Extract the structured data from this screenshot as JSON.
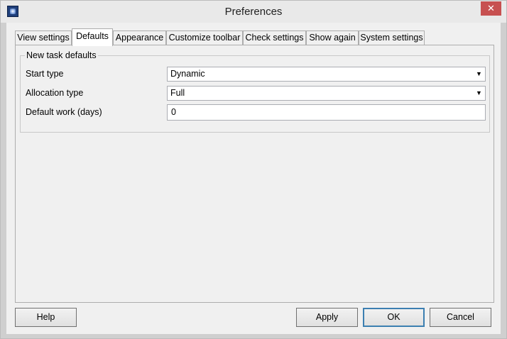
{
  "window": {
    "title": "Preferences",
    "close_glyph": "✕"
  },
  "tabs": [
    {
      "label": "View settings"
    },
    {
      "label": "Defaults"
    },
    {
      "label": "Appearance"
    },
    {
      "label": "Customize toolbar"
    },
    {
      "label": "Check settings"
    },
    {
      "label": "Show again"
    },
    {
      "label": "System settings"
    }
  ],
  "active_tab": "Defaults",
  "group": {
    "legend": "New task defaults",
    "start_type": {
      "label": "Start type",
      "value": "Dynamic"
    },
    "allocation_type": {
      "label": "Allocation type",
      "value": "Full"
    },
    "default_work": {
      "label": "Default work (days)",
      "value": "0"
    }
  },
  "dropdown_glyph": "▼",
  "buttons": {
    "help": "Help",
    "apply": "Apply",
    "ok": "OK",
    "cancel": "Cancel"
  },
  "icons": {
    "app": "app-icon",
    "close": "close-icon",
    "dropdown": "chevron-down-icon"
  },
  "colors": {
    "close_button": "#c75050",
    "default_button_border": "#3c7fb1"
  }
}
